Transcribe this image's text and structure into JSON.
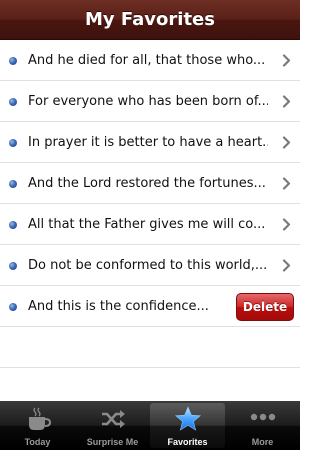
{
  "navbar": {
    "title": "My Favorites"
  },
  "favorites": [
    {
      "text": "And he died for all, that those who..."
    },
    {
      "text": "For everyone who has been born of..."
    },
    {
      "text": "In prayer it is better to have a heart..."
    },
    {
      "text": "And the Lord restored the fortunes..."
    },
    {
      "text": "All that the Father gives me will co..."
    },
    {
      "text": "Do not be conformed to this world,..."
    },
    {
      "text": "And this is the confidence..."
    }
  ],
  "delete_label": "Delete",
  "tabs": [
    {
      "label": "Today",
      "icon": "coffee-cup-icon"
    },
    {
      "label": "Surprise Me",
      "icon": "shuffle-icon"
    },
    {
      "label": "Favorites",
      "icon": "star-icon",
      "selected": true
    },
    {
      "label": "More",
      "icon": "more-dots-icon"
    }
  ],
  "colors": {
    "navbar": "#5a2018",
    "bullet": "#3d6bb6",
    "delete": "#cc2424",
    "tab_selected_icon": "#4a9fff"
  }
}
